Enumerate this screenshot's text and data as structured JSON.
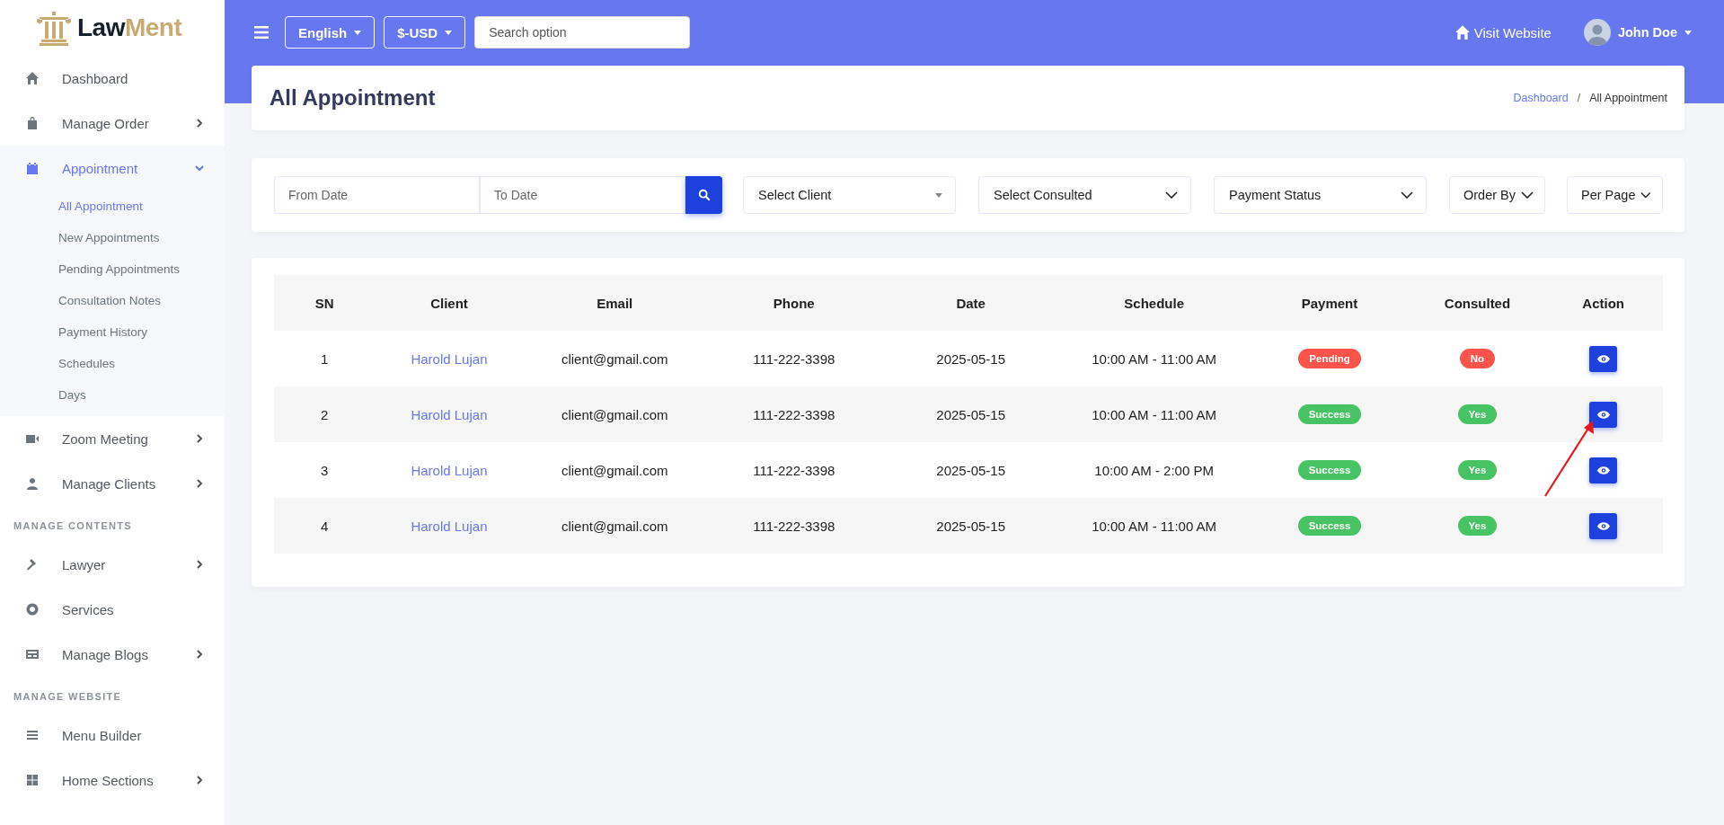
{
  "brand": {
    "name_part_1": "Law",
    "name_part_2": "Ment"
  },
  "sidebar": [
    {
      "kind": "item",
      "label": "Dashboard",
      "selected": false
    },
    {
      "kind": "item",
      "label": "Manage Order",
      "selected": false,
      "expanded": false
    },
    {
      "kind": "item",
      "label": "Appointment",
      "selected": true,
      "expanded": true,
      "children": [
        {
          "label": "All Appointment",
          "selected": true
        },
        {
          "label": "New Appointments",
          "selected": false
        },
        {
          "label": "Pending Appointments",
          "selected": false
        },
        {
          "label": "Consultation Notes",
          "selected": false
        },
        {
          "label": "Payment History",
          "selected": false
        },
        {
          "label": "Schedules",
          "selected": false
        },
        {
          "label": "Days",
          "selected": false
        }
      ]
    },
    {
      "kind": "item",
      "label": "Zoom Meeting",
      "selected": false,
      "expanded": false
    },
    {
      "kind": "item",
      "label": "Manage Clients",
      "selected": false,
      "expanded": false
    },
    {
      "kind": "heading",
      "label": "MANAGE CONTENTS"
    },
    {
      "kind": "item",
      "label": "Lawyer",
      "selected": false,
      "expanded": false
    },
    {
      "kind": "item",
      "label": "Services",
      "selected": false
    },
    {
      "kind": "item",
      "label": "Manage Blogs",
      "selected": false,
      "expanded": false
    },
    {
      "kind": "heading",
      "label": "MANAGE WEBSITE"
    },
    {
      "kind": "item",
      "label": "Menu Builder",
      "selected": false
    },
    {
      "kind": "item",
      "label": "Home Sections",
      "selected": false,
      "expanded": false
    }
  ],
  "topbar": {
    "language": "English",
    "currency": "$-USD",
    "search": {
      "placeholder": "Search option"
    },
    "visit_website": "Visit Website",
    "user": "John Doe"
  },
  "page": {
    "title": "All Appointment",
    "breadcrumb_separator": "/",
    "breadcrumb": [
      {
        "label": "Dashboard",
        "link": true
      },
      {
        "label": "All Appointment",
        "link": false
      }
    ]
  },
  "filters": {
    "from_date": {
      "placeholder": "From Date"
    },
    "to_date": {
      "placeholder": "To Date"
    },
    "selects": [
      "Select Client",
      "Select Consulted",
      "Payment Status",
      "Order By",
      "Per Page"
    ]
  },
  "table": {
    "columns": [
      "SN",
      "Client",
      "Email",
      "Phone",
      "Date",
      "Schedule",
      "Payment",
      "Consulted",
      "Action"
    ],
    "rows": [
      {
        "sn": "1",
        "client": "Harold Lujan",
        "email": "client@gmail.com",
        "phone": "111-222-3398",
        "date": "2025-05-15",
        "schedule": "10:00 AM - 11:00 AM",
        "payment": {
          "label": "Pending",
          "kind": "pending"
        },
        "consulted": {
          "label": "No",
          "kind": "no"
        }
      },
      {
        "sn": "2",
        "client": "Harold Lujan",
        "email": "client@gmail.com",
        "phone": "111-222-3398",
        "date": "2025-05-15",
        "schedule": "10:00 AM - 11:00 AM",
        "payment": {
          "label": "Success",
          "kind": "success"
        },
        "consulted": {
          "label": "Yes",
          "kind": "yes"
        }
      },
      {
        "sn": "3",
        "client": "Harold Lujan",
        "email": "client@gmail.com",
        "phone": "111-222-3398",
        "date": "2025-05-15",
        "schedule": "10:00 AM - 2:00 PM",
        "payment": {
          "label": "Success",
          "kind": "success"
        },
        "consulted": {
          "label": "Yes",
          "kind": "yes"
        }
      },
      {
        "sn": "4",
        "client": "Harold Lujan",
        "email": "client@gmail.com",
        "phone": "111-222-3398",
        "date": "2025-05-15",
        "schedule": "10:00 AM - 11:00 AM",
        "payment": {
          "label": "Success",
          "kind": "success"
        },
        "consulted": {
          "label": "Yes",
          "kind": "yes"
        }
      }
    ]
  }
}
